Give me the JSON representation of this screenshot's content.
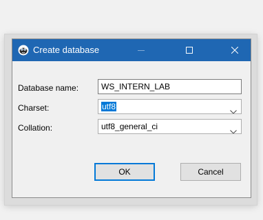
{
  "window": {
    "title": "Create database",
    "icon": "database-app-icon",
    "controls": [
      "minimize-icon",
      "maximize-icon",
      "close-icon"
    ]
  },
  "form": {
    "database_name": {
      "label": "Database name:",
      "value": "WS_INTERN_LAB"
    },
    "charset": {
      "label": "Charset:",
      "value": "utf8",
      "text_selected": true
    },
    "collation": {
      "label": "Collation:",
      "value": "utf8_general_ci"
    }
  },
  "buttons": {
    "ok": "OK",
    "cancel": "Cancel"
  },
  "colors": {
    "titlebar": "#1f67b3",
    "selection": "#0078d7",
    "dialog_bg": "#f0f0f0"
  }
}
